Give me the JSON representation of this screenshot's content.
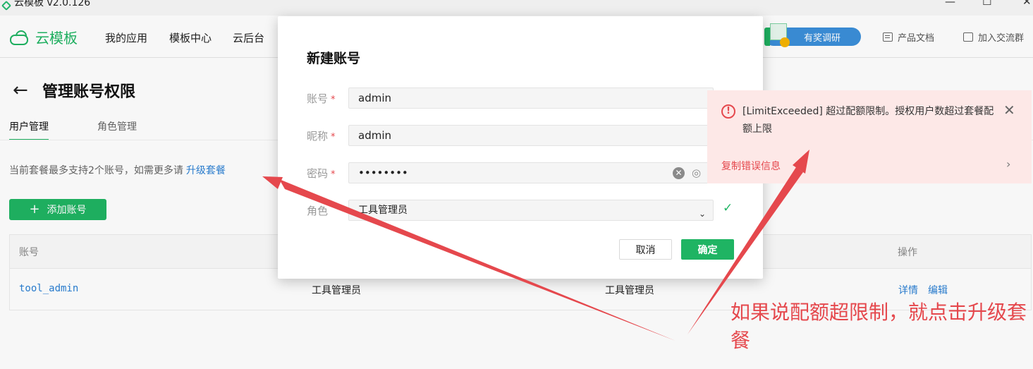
{
  "window": {
    "title": "云模板 v2.0.126",
    "minimize": "—",
    "maximize": "☐",
    "close": "✕"
  },
  "nav": {
    "brand": "云模板",
    "items": [
      "我的应用",
      "模板中心",
      "云后台"
    ],
    "survey_label": "有奖调研",
    "docs_label": "产品文档",
    "community_label": "加入交流群"
  },
  "page": {
    "back_glyph": "←",
    "title": "管理账号权限",
    "tabs": [
      {
        "label": "用户管理",
        "active": true
      },
      {
        "label": "角色管理",
        "active": false
      }
    ],
    "notice_text": "当前套餐最多支持2个账号，如需更多请",
    "notice_link": "升级套餐",
    "add_button": "添加账号",
    "table": {
      "columns": [
        "账号",
        "操作"
      ],
      "rows": [
        {
          "account": "tool_admin",
          "col2": "工具管理员",
          "col3": "工具管理员",
          "detail": "详情",
          "edit": "编辑"
        }
      ]
    }
  },
  "modal": {
    "title": "新建账号",
    "fields": [
      {
        "label": "账号",
        "value": "admin",
        "required": true
      },
      {
        "label": "昵称",
        "value": "admin",
        "required": true
      },
      {
        "label": "密码",
        "value": "••••••••",
        "required": true
      },
      {
        "label": "角色",
        "value": "工具管理员",
        "required": false
      }
    ],
    "cancel": "取消",
    "confirm": "确定"
  },
  "toast": {
    "icon": "!",
    "message": "[LimitExceeded] 超过配额限制。授权用户数超过套餐配额上限",
    "close": "✕",
    "copy_label": "复制错误信息",
    "chevron": "›"
  },
  "annotation": {
    "text": "如果说配额超限制，就点击升级套餐",
    "color": "#e5484d"
  },
  "colors": {
    "accent": "#1fb463",
    "link": "#2a7fd3",
    "error": "#e5484d"
  }
}
